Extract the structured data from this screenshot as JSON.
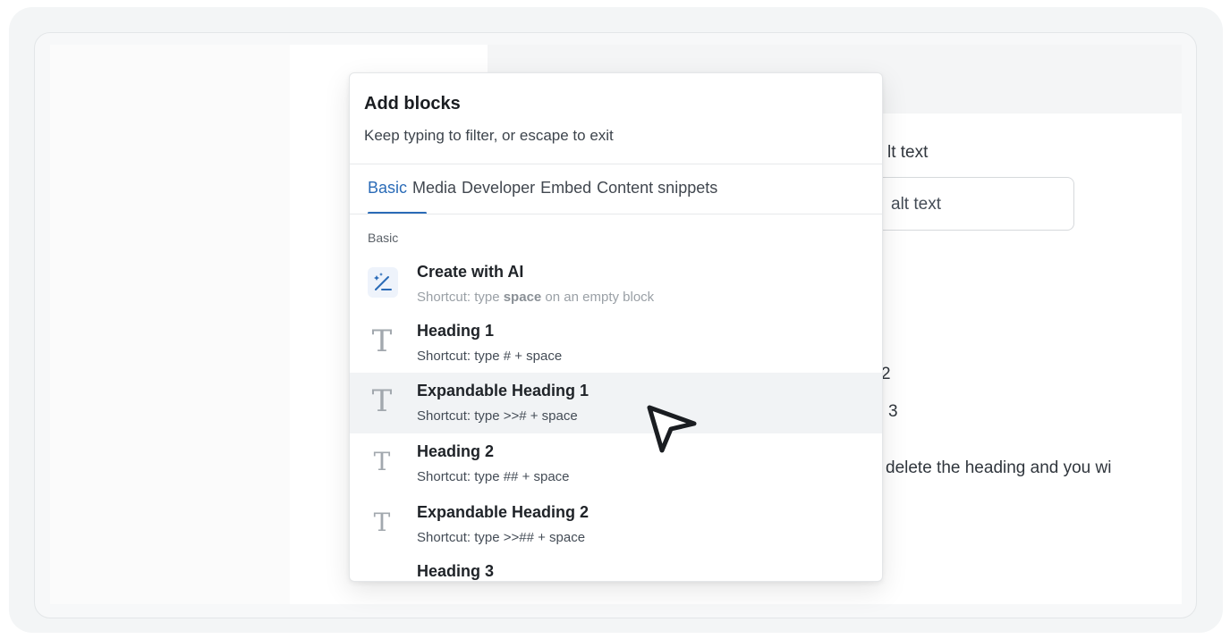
{
  "background_editor": {
    "alt_label": "lt text",
    "alt_input_value": "alt text",
    "fragment_two": "2",
    "fragment_three": "3",
    "fragment_delete": "delete the heading and you wi"
  },
  "popup": {
    "title": "Add blocks",
    "subtitle": "Keep typing to filter, or escape to exit",
    "tabs": [
      {
        "label": "Basic",
        "active": true
      },
      {
        "label": "Media",
        "active": false
      },
      {
        "label": "Developer",
        "active": false
      },
      {
        "label": "Embed",
        "active": false
      },
      {
        "label": "Content snippets",
        "active": false
      }
    ],
    "section_label": "Basic",
    "items": [
      {
        "title": "Create with AI",
        "hint_prefix": "Shortcut: type ",
        "hint_bold": "space",
        "hint_suffix": " on an empty block",
        "icon": "magic-wand-icon"
      },
      {
        "title": "Heading 1",
        "hint": "Shortcut: type # + space",
        "icon": "text-icon"
      },
      {
        "title": "Expandable Heading 1",
        "hint": "Shortcut: type >># + space",
        "icon": "text-icon",
        "highlighted": true
      },
      {
        "title": "Heading 2",
        "hint": "Shortcut: type ## + space",
        "icon": "text-icon"
      },
      {
        "title": "Expandable Heading 2",
        "hint": "Shortcut: type >>## + space",
        "icon": "text-icon"
      },
      {
        "title": "Heading 3",
        "hint": "",
        "icon": "text-icon"
      }
    ]
  },
  "colors": {
    "accent": "#2a6bb7",
    "highlight_row": "#f1f3f5",
    "icon_gray": "#a2a8ae"
  },
  "cursor": {
    "icon": "mouse-pointer-icon"
  }
}
